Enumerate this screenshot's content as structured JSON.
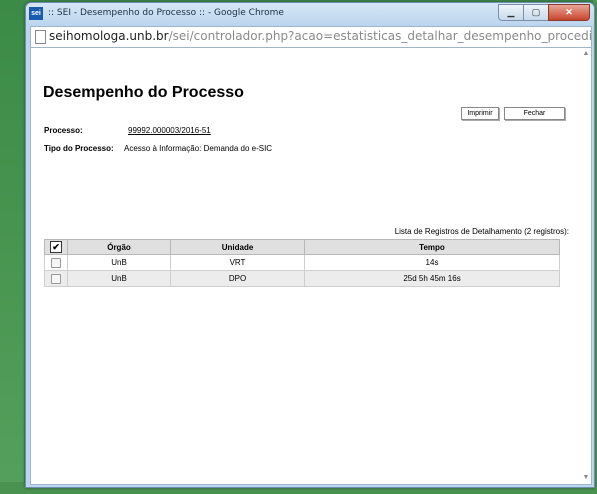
{
  "window": {
    "favicon": "sei",
    "title": ":: SEI - Desempenho do Processo :: - Google Chrome",
    "min_icon": "minimize-icon",
    "max_icon": "maximize-icon",
    "close_icon": "close-icon"
  },
  "address": {
    "host": "seihomologa.unb.br",
    "path": "/sei/controlador.php?acao=estatisticas_detalhar_desempenho_procedimento&id_e"
  },
  "page": {
    "title": "Desempenho do Processo",
    "print_label": "Imprimir",
    "close_label": "Fechar",
    "processo_label": "Processo:",
    "processo_value": "99992.000003/2016-51",
    "tipo_label": "Tipo do Processo:",
    "tipo_value": "Acesso à Informação: Demanda do e-SIC"
  },
  "table": {
    "caption": "Lista de Registros de Detalhamento (2 registros):",
    "select_all": "✔",
    "columns": [
      "Órgão",
      "Unidade",
      "Tempo"
    ],
    "rows": [
      {
        "orgao": "UnB",
        "unidade": "VRT",
        "tempo": "14s"
      },
      {
        "orgao": "UnB",
        "unidade": "DPO",
        "tempo": "25d 5h 45m 16s"
      }
    ]
  }
}
